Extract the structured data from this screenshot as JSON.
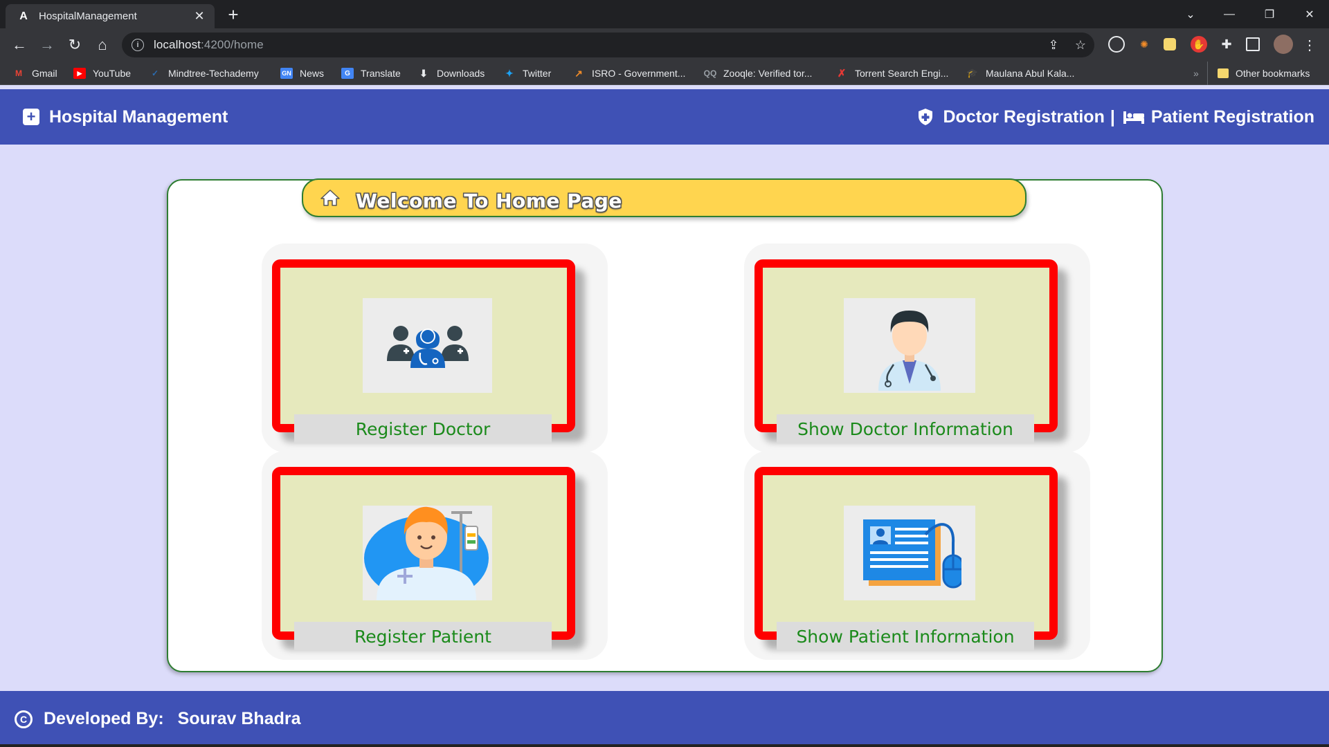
{
  "browser": {
    "tab_title": "HospitalManagement",
    "tab_favicon": "A",
    "url_host": "localhost",
    "url_path": ":4200/home",
    "bookmarks": [
      {
        "label": "Gmail",
        "icon": "gmail-icon",
        "color": "#ea4335"
      },
      {
        "label": "YouTube",
        "icon": "youtube-icon",
        "color": "#ff0000"
      },
      {
        "label": "Mindtree-Techademy",
        "icon": "mindtree-icon",
        "color": "#2b6cb0"
      },
      {
        "label": "News",
        "icon": "google-news-icon",
        "color": "#4285f4"
      },
      {
        "label": "Translate",
        "icon": "translate-icon",
        "color": "#4285f4"
      },
      {
        "label": "Downloads",
        "icon": "download-icon",
        "color": "#e8eaed"
      },
      {
        "label": "Twitter",
        "icon": "twitter-icon",
        "color": "#1da1f2"
      },
      {
        "label": "ISRO - Government...",
        "icon": "isro-icon",
        "color": "#f28c28"
      },
      {
        "label": "Zooqle: Verified tor...",
        "icon": "zooqle-icon",
        "color": "#9aa0a6"
      },
      {
        "label": "Torrent Search Engi...",
        "icon": "torrent-icon",
        "color": "#e53935"
      },
      {
        "label": "Maulana Abul Kala...",
        "icon": "graduation-cap-icon",
        "color": "#9aa0a6"
      }
    ],
    "other_bookmarks": "Other bookmarks"
  },
  "header": {
    "brand": "Hospital Management",
    "nav_doctor": "Doctor Registration",
    "nav_separator": "|",
    "nav_patient": "Patient Registration"
  },
  "main": {
    "welcome_title": "Welcome To Home Page",
    "cards": [
      {
        "label": "Register Doctor",
        "icon": "doctors-group-icon"
      },
      {
        "label": "Show Doctor Information",
        "icon": "doctor-icon"
      },
      {
        "label": "Register Patient",
        "icon": "patient-icon"
      },
      {
        "label": "Show Patient Information",
        "icon": "patient-record-icon"
      }
    ]
  },
  "footer": {
    "developed_by_label": "Developed By:",
    "developer_name": "Sourav Bhadra"
  },
  "colors": {
    "appbar": "#3f51b5",
    "page_bg": "#dcdcfa",
    "card_border": "#ff0000",
    "card_bg": "#e6e9bd",
    "card_label": "#1b8a1b",
    "welcome_bg": "#ffd54f",
    "container_border": "#2e7d32"
  }
}
